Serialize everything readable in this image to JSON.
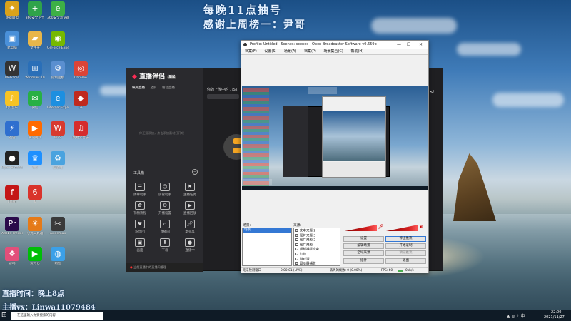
{
  "overlay": {
    "line1": "每晚11点抽号",
    "line2": "感谢上周榜一：尹哥",
    "bottom1": "直播时间：晚上8点",
    "bottom2": "主播vx：Linwa11079484"
  },
  "desktop_icons": [
    {
      "label": "英雄联盟",
      "icon": "game-icon",
      "color": "#d9a21b",
      "glyph": "✦"
    },
    {
      "label": "360安全卫士",
      "icon": "shield-icon",
      "color": "#2fa34a",
      "glyph": "+"
    },
    {
      "label": "360安全浏览器",
      "icon": "browser-icon",
      "color": "#3db046",
      "glyph": "e"
    },
    {
      "label": "此电脑",
      "icon": "computer-icon",
      "color": "#4a90d9",
      "glyph": "▣"
    },
    {
      "label": "文件夹",
      "icon": "folder-icon",
      "color": "#e8b64a",
      "glyph": "▰"
    },
    {
      "label": "GeForce Experience",
      "icon": "nvidia-icon",
      "color": "#76b900",
      "glyph": "◉"
    },
    {
      "label": "WeGame",
      "icon": "wegame-icon",
      "color": "#333",
      "glyph": "W"
    },
    {
      "label": "Windows 10",
      "icon": "windows-icon",
      "color": "#2a6fb8",
      "glyph": "⊞"
    },
    {
      "label": "控制面板",
      "icon": "control-panel-icon",
      "color": "#5a8fd0",
      "glyph": "⚙"
    },
    {
      "label": "Chrome",
      "icon": "chrome-icon",
      "color": "#db4437",
      "glyph": "◎"
    },
    {
      "label": "QQ音乐",
      "icon": "music-icon",
      "color": "#f7c325",
      "glyph": "♪"
    },
    {
      "label": "微信",
      "icon": "wechat-icon",
      "color": "#28b045",
      "glyph": "✉"
    },
    {
      "label": "Internet Explorer",
      "icon": "ie-icon",
      "color": "#1d8fe0",
      "glyph": "e"
    },
    {
      "label": "GF",
      "icon": "gf-icon",
      "color": "#c02a1f",
      "glyph": "◆"
    },
    {
      "label": "迅雷",
      "icon": "thunder-icon",
      "color": "#2f6fcf",
      "glyph": "⚡"
    },
    {
      "label": "腾讯视频",
      "icon": "video-icon",
      "color": "#ff6a00",
      "glyph": "▶"
    },
    {
      "label": "WPS",
      "icon": "wps-icon",
      "color": "#d83a2f",
      "glyph": "W"
    },
    {
      "label": "网易云音乐",
      "icon": "netease-icon",
      "color": "#d62c2c",
      "glyph": "♫"
    },
    {
      "label": "Open Broadcaster",
      "icon": "obs-icon",
      "color": "#222",
      "glyph": "●"
    },
    {
      "label": "QQ",
      "icon": "qq-icon",
      "color": "#1e90ff",
      "glyph": "♛"
    },
    {
      "label": "回收站",
      "icon": "recycle-bin-icon",
      "color": "#4aa3df",
      "glyph": "♻"
    },
    {
      "label": "Flash",
      "icon": "flash-icon",
      "color": "#c41616",
      "glyph": "f"
    },
    {
      "label": "6",
      "icon": "six-icon",
      "color": "#d9332b",
      "glyph": "6"
    },
    {
      "label": "Adobe Premiere",
      "icon": "premiere-icon",
      "color": "#2a0a4a",
      "glyph": "Pr"
    },
    {
      "label": "小丸工具箱",
      "icon": "toolbox-icon",
      "color": "#e57a18",
      "glyph": "☀"
    },
    {
      "label": "Avidemux",
      "icon": "avidemux-icon",
      "color": "#3a3a3a",
      "glyph": "✂"
    },
    {
      "label": "游戏",
      "icon": "games-folder-icon",
      "color": "#e34f7a",
      "glyph": "❖"
    },
    {
      "label": "爱奇艺",
      "icon": "iqiyi-icon",
      "color": "#00be06",
      "glyph": "▶"
    },
    {
      "label": "网络",
      "icon": "network-icon",
      "color": "#3ba0e8",
      "glyph": "◍"
    }
  ],
  "live_app": {
    "logo": "直播伴侣",
    "version": "测试",
    "tabs": [
      "横屏直播",
      "竖屏",
      "语音直播"
    ],
    "empty_hint": "你还没添加，点击添加素材打开吧",
    "notice": "你的上传中的 刀Ss",
    "tools_title": "工具箱",
    "tools": [
      "弹幕助手",
      "房管助手",
      "主播任务",
      "礼物流程",
      "开播设置",
      "直播回放",
      "粉丝团",
      "直播间",
      "麦克风",
      "画面",
      "下载",
      "直播中"
    ],
    "bottom_tip": "当前直播中的直播间管理"
  },
  "obs": {
    "title": "Profile: Untitled - Scenes: scenes - Open Broadcaster Software v0.659b",
    "menu": [
      "档案(F)",
      "设置(S)",
      "场景(A)",
      "档案(P)",
      "场景集合(C)",
      "帮助(H)"
    ],
    "scenes_label": "场景:",
    "scene_item": "场景",
    "sources_label": "来源:",
    "sources": [
      "文本来源 2",
      "图片来源 3",
      "图片来源 2",
      "图片来源",
      "视频捕捉设备",
      "红包",
      "游戏源",
      "显示器捕获"
    ],
    "buttons": [
      "设置",
      "停止推流",
      "编辑场景",
      "开始录制",
      "全域来源",
      "预览推流",
      "插件",
      "退出"
    ],
    "status": {
      "left": "无法检测窗口",
      "time": "0:00:01 (LIVE)",
      "dropped": "丢失的帧数: 0 (0.00%)",
      "fps": "FPS: 60",
      "bitrate": "0kb/s"
    }
  },
  "taskbar": {
    "search_placeholder": "在这里输入你要搜索的内容",
    "time": "22:00",
    "date": "2021/11/27",
    "tray_lang": "中"
  }
}
